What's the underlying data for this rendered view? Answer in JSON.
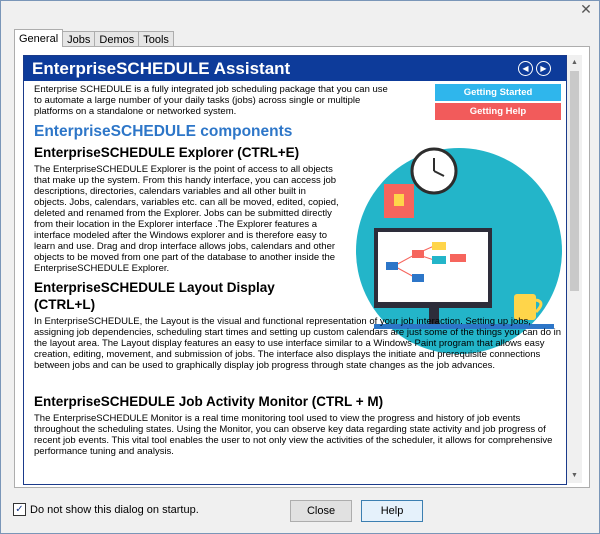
{
  "window": {
    "close_glyph": "✕"
  },
  "tabs": [
    {
      "label": "General",
      "active": true
    },
    {
      "label": "Jobs",
      "active": false
    },
    {
      "label": "Demos",
      "active": false
    },
    {
      "label": "Tools",
      "active": false
    }
  ],
  "banner": {
    "title": "EnterpriseSCHEDULE Assistant",
    "prev_glyph": "◀",
    "next_glyph": "▶"
  },
  "intro": {
    "text": "Enterprise SCHEDULE is a fully integrated job scheduling package that you can use to automate a large number of your daily tasks (jobs) across single or multiple platforms on a standalone or networked system."
  },
  "side_buttons": {
    "getting_started": "Getting Started",
    "getting_help": "Getting Help"
  },
  "components_heading": "EnterpriseSCHEDULE components",
  "sections": {
    "explorer": {
      "title": "EnterpriseSCHEDULE Explorer (CTRL+E)",
      "body": "The EnterpriseSCHEDULE Explorer is the point of access to all objects that make up the system. From this handy interface, you can access job descriptions, directories, calendars variables and all other built in objects. Jobs, calendars, variables etc. can all be moved, edited, copied, deleted and renamed from the Explorer. Jobs can be submitted directly from their location in the Explorer interface .The Explorer features a interface modeled after the Windows explorer and is therefore easy to learn and use. Drag and drop interface allows jobs, calendars and other objects to be moved from one part of the database to another inside the EnterpriseSCHEDULE Explorer."
    },
    "layout": {
      "title_line1": "EnterpriseSCHEDULE Layout Display",
      "title_line2": "(CTRL+L)",
      "body": "In EnterpriseSCHEDULE, the Layout is the visual and functional representation of your job interaction. Setting up jobs, assigning job dependencies, scheduling start times and setting up custom calendars are just some of the things you can do in the layout area. The Layout display features an easy to use interface similar to a Windows Paint program that allows easy creation, editing, movement, and submission of jobs. The interface also displays the initiate and prerequisite connections between jobs and can be used to graphically display job progress through state changes as the job advances."
    },
    "monitor": {
      "title": "EnterpriseSCHEDULE Job Activity Monitor (CTRL + M)",
      "body": "The EnterpriseSCHEDULE Monitor is a real time monitoring tool used to view the progress and history of job events throughout the scheduling states. Using the Monitor, you can observe key data regarding state activity and job progress of recent job events.  This vital tool enables the user to not only view the activities of the scheduler, it allows for comprehensive performance tuning and analysis."
    }
  },
  "scrollbar": {
    "up_glyph": "▲",
    "down_glyph": "▼"
  },
  "footer": {
    "checkbox_label": "Do not show this dialog on startup.",
    "checkbox_checked": true,
    "check_glyph": "✓",
    "close_label": "Close",
    "help_label": "Help"
  }
}
